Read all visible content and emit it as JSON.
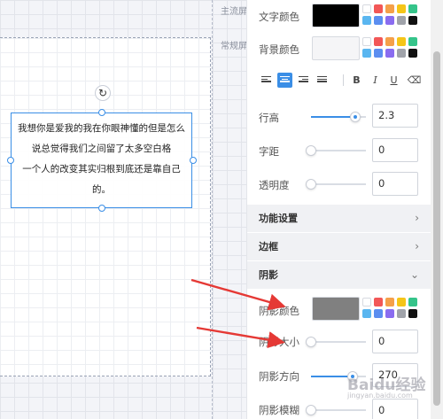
{
  "canvas": {
    "screen_labels": [
      "主流屏",
      "常规屏"
    ],
    "text_element": {
      "lines": [
        "我想你是爱我的我在你眼神懂的但是怎么",
        "说总觉得我们之间留了太多空白格",
        "一个人的改变其实归根到底还是靠自己",
        "的。"
      ],
      "rotate_icon": "rotate-icon"
    }
  },
  "panel": {
    "text_color": {
      "label": "文字颜色",
      "value": "#000000"
    },
    "bg_color": {
      "label": "背景颜色",
      "value": "#f5f5f7"
    },
    "palette": [
      "#ffffff",
      "#f25757",
      "#f5a04a",
      "#f5c518",
      "#35c48a",
      "#5ab6f0",
      "#5b8ef0",
      "#8a6cf0",
      "#a0a3aa",
      "#111111"
    ],
    "format_toolbar": {
      "align_left": "align-left-icon",
      "align_center": "align-center-icon",
      "align_right": "align-right-icon",
      "align_justify": "align-justify-icon",
      "bold_label": "B",
      "italic_label": "I",
      "underline_label": "U",
      "eraser": "eraser-icon"
    },
    "line_height": {
      "label": "行高",
      "value": "2.3",
      "fraction": 0.8
    },
    "letter_spacing": {
      "label": "字距",
      "value": "0",
      "fraction": 0
    },
    "opacity": {
      "label": "透明度",
      "value": "0",
      "fraction": 0
    },
    "sections": {
      "function": "功能设置",
      "border": "边框",
      "shadow": "阴影"
    },
    "shadow_color": {
      "label": "阴影颜色",
      "value": "#808080"
    },
    "shadow_size": {
      "label": "阴影大小",
      "value": "0",
      "fraction": 0
    },
    "shadow_direction": {
      "label": "阴影方向",
      "value": "270",
      "fraction": 0.75
    },
    "shadow_blur": {
      "label": "阴影模糊",
      "value": "0",
      "fraction": 0
    },
    "chevrons": {
      "right": "›",
      "down": "⌄"
    }
  },
  "watermark": {
    "text": "Baidu经验",
    "sub": "jingyan.baidu.com"
  },
  "annotations": {
    "arrow_color": "#e53935"
  }
}
